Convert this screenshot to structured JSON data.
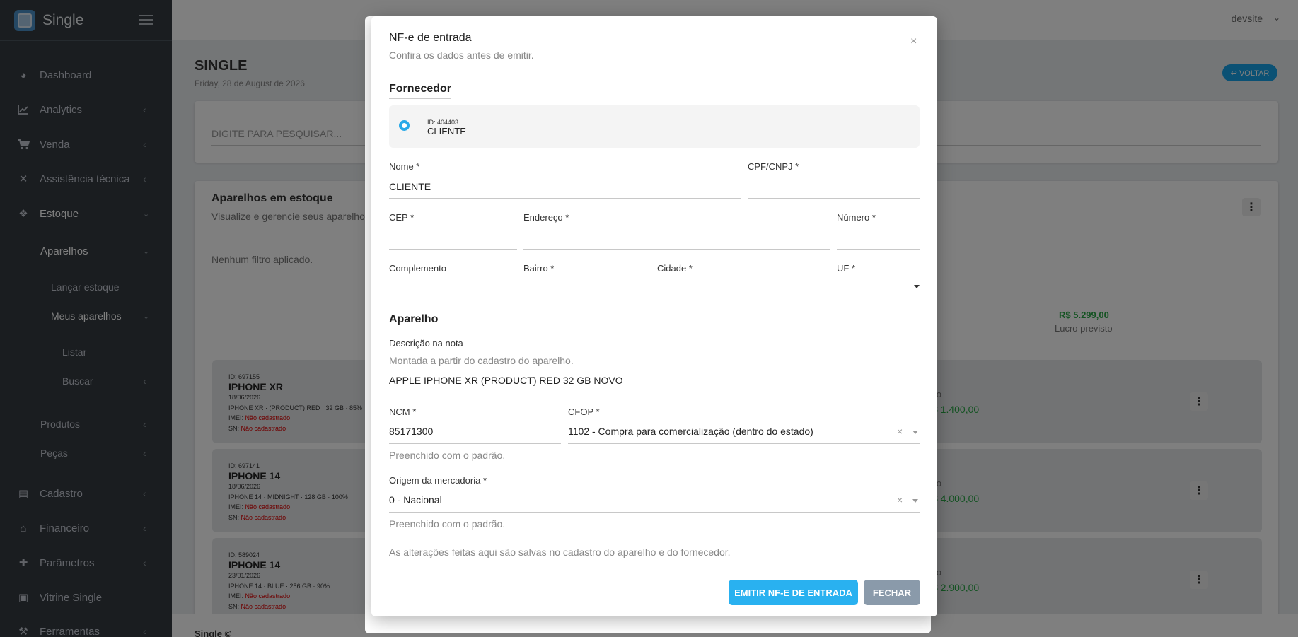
{
  "brand": {
    "name": "Single"
  },
  "sidebar": {
    "items": [
      {
        "label": "Dashboard",
        "icon": "dashboard-icon"
      },
      {
        "label": "Analytics",
        "icon": "chart-icon"
      },
      {
        "label": "Venda",
        "icon": "cart-icon"
      },
      {
        "label": "Assistência técnica",
        "icon": "tools-icon"
      },
      {
        "label": "Estoque",
        "icon": "cubes-icon"
      },
      {
        "label": "Aparelhos"
      },
      {
        "label": "Lançar estoque"
      },
      {
        "label": "Meus aparelhos"
      },
      {
        "label": "Listar"
      },
      {
        "label": "Buscar"
      },
      {
        "label": "Produtos"
      },
      {
        "label": "Peças"
      },
      {
        "label": "Cadastro",
        "icon": "id-card-icon"
      },
      {
        "label": "Financeiro",
        "icon": "bank-icon"
      },
      {
        "label": "Parâmetros",
        "icon": "puzzle-icon"
      },
      {
        "label": "Vitrine Single",
        "icon": "lock-icon"
      },
      {
        "label": "Ferramentas",
        "icon": "wrench-icon"
      }
    ]
  },
  "topbar": {
    "user": "devsite"
  },
  "page": {
    "title": "SINGLE",
    "date": "Friday, 28 de August de 2026",
    "back_label": "↩ VOLTAR",
    "search_placeholder": "DIGITE PARA PESQUISAR...",
    "stock_title": "Aparelhos em estoque",
    "stock_subtitle": "Visualize e gerencie seus aparelhos",
    "filter_text": "Nenhum filtro aplicado.",
    "profit_value": "R$ 5.299,00",
    "profit_label": "Lucro previsto",
    "footer": "Single ©"
  },
  "items": [
    {
      "id": "ID: 697155",
      "name": "IPHONE XR",
      "date": "18/06/2026",
      "desc": "IPHONE XR · (PRODUCT) RED · 32 GB · 85%",
      "imei_label": "IMEI:",
      "imei": "Não cadastrado",
      "sn_label": "SN:",
      "sn": "Não cadastrado",
      "price_label": "eço",
      "price": "$ 1.400,00"
    },
    {
      "id": "ID: 697141",
      "name": "IPHONE 14",
      "date": "18/06/2026",
      "desc": "IPHONE 14 · MIDNIGHT · 128 GB · 100%",
      "imei_label": "IMEI:",
      "imei": "Não cadastrado",
      "sn_label": "SN:",
      "sn": "Não cadastrado",
      "price_label": "eço",
      "price": "$ 4.000,00"
    },
    {
      "id": "ID: 589024",
      "name": "IPHONE 14",
      "date": "23/01/2026",
      "desc": "IPHONE 14 · BLUE · 256 GB · 90%",
      "imei_label": "IMEI:",
      "imei": "Não cadastrado",
      "sn_label": "SN:",
      "sn": "Não cadastrado",
      "price_label": "eço",
      "price": "$ 2.900,00"
    }
  ],
  "modal": {
    "title": "NF-e de entrada",
    "subtitle": "Confira os dados antes de emitir.",
    "close": "×",
    "supplier_section": "Fornecedor",
    "supplier_id": "ID: 404403",
    "supplier_name": "CLIENTE",
    "fields": {
      "nome_label": "Nome *",
      "nome_value": "CLIENTE",
      "cpf_label": "CPF/CNPJ *",
      "cep_label": "CEP *",
      "endereco_label": "Endereço *",
      "numero_label": "Número *",
      "complemento_label": "Complemento",
      "bairro_label": "Bairro *",
      "cidade_label": "Cidade *",
      "uf_label": "UF *"
    },
    "device_section": "Aparelho",
    "descricao_label": "Descrição na nota",
    "descricao_hint": "Montada a partir do cadastro do aparelho.",
    "descricao_value": "APPLE IPHONE XR (PRODUCT) RED 32 GB NOVO",
    "ncm_label": "NCM *",
    "ncm_value": "85171300",
    "cfop_label": "CFOP *",
    "cfop_value": "1102 - Compra para comercialização (dentro do estado)",
    "default_hint": "Preenchido com o padrão.",
    "origem_label": "Origem da mercadoria *",
    "origem_value": "0 - Nacional",
    "origem_hint": "Preenchido com o padrão.",
    "note": "As alterações feitas aqui são salvas no cadastro do aparelho e do fornecedor.",
    "emit_label": "EMITIR NF-E DE ENTRADA",
    "close_label": "FECHAR"
  }
}
